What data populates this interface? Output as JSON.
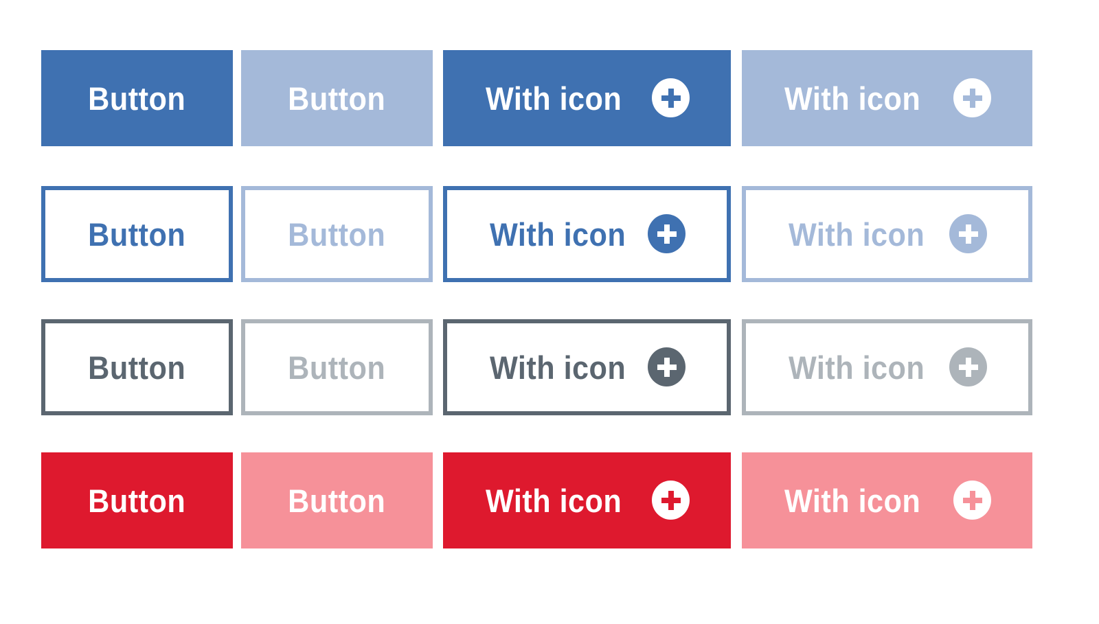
{
  "labels": {
    "button": "Button",
    "with_icon": "With icon"
  },
  "icon": "plus-circle-icon",
  "colors": {
    "primary_blue": "#3F71B1",
    "primary_blue_disabled": "#A4B9D9",
    "neutral_gray": "#5B6670",
    "neutral_gray_disabled": "#ADB4BA",
    "danger_red": "#DE192E",
    "danger_red_disabled": "#F69199",
    "white": "#FFFFFF"
  },
  "rows": [
    {
      "variant": "primary-filled",
      "buttons": [
        {
          "label": "Button",
          "state": "enabled"
        },
        {
          "label": "Button",
          "state": "disabled"
        },
        {
          "label": "With icon",
          "state": "enabled",
          "icon": "plus-circle-icon"
        },
        {
          "label": "With icon",
          "state": "disabled",
          "icon": "plus-circle-icon"
        }
      ]
    },
    {
      "variant": "primary-outline",
      "buttons": [
        {
          "label": "Button",
          "state": "enabled"
        },
        {
          "label": "Button",
          "state": "disabled"
        },
        {
          "label": "With icon",
          "state": "enabled",
          "icon": "plus-circle-icon"
        },
        {
          "label": "With icon",
          "state": "disabled",
          "icon": "plus-circle-icon"
        }
      ]
    },
    {
      "variant": "secondary-outline",
      "buttons": [
        {
          "label": "Button",
          "state": "enabled"
        },
        {
          "label": "Button",
          "state": "disabled"
        },
        {
          "label": "With icon",
          "state": "enabled",
          "icon": "plus-circle-icon"
        },
        {
          "label": "With icon",
          "state": "disabled",
          "icon": "plus-circle-icon"
        }
      ]
    },
    {
      "variant": "danger-filled",
      "buttons": [
        {
          "label": "Button",
          "state": "enabled"
        },
        {
          "label": "Button",
          "state": "disabled"
        },
        {
          "label": "With icon",
          "state": "enabled",
          "icon": "plus-circle-icon"
        },
        {
          "label": "With icon",
          "state": "disabled",
          "icon": "plus-circle-icon"
        }
      ]
    }
  ]
}
